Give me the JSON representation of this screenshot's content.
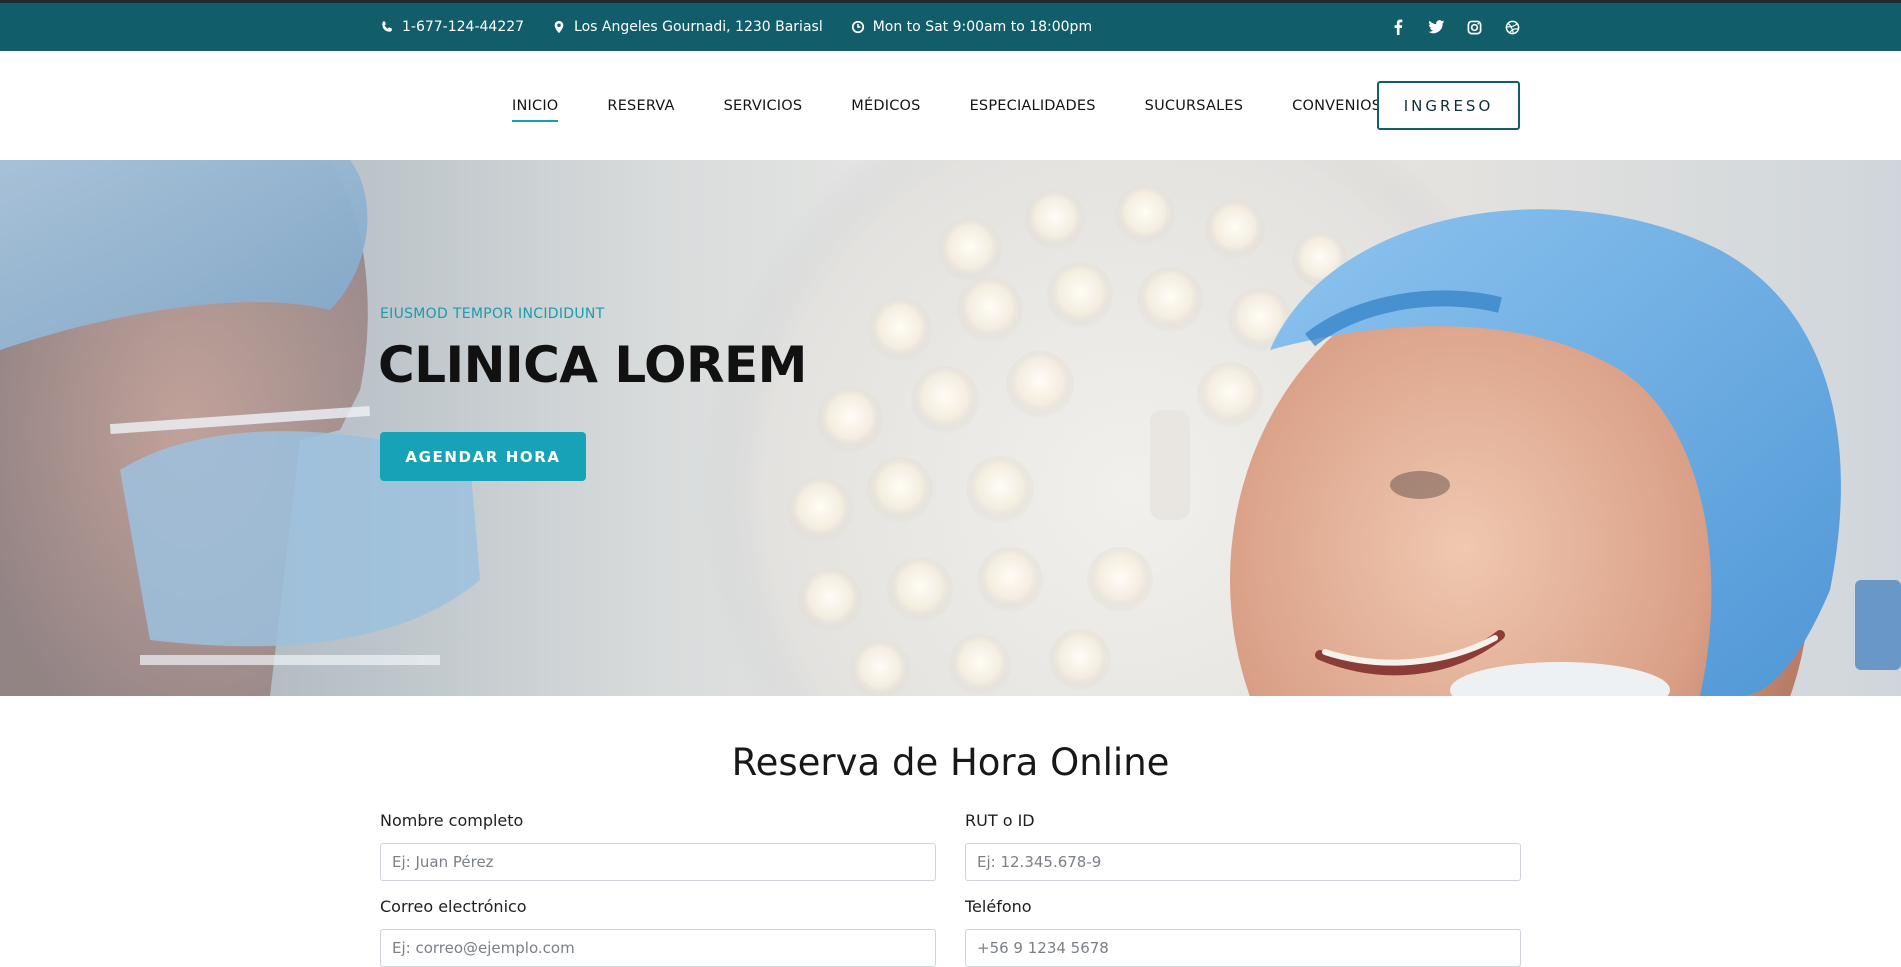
{
  "topbar": {
    "phone": "1-677-124-44227",
    "address": "Los Angeles Gournadi, 1230 Bariasl",
    "hours": "Mon to Sat 9:00am to 18:00pm",
    "socials": [
      "facebook-icon",
      "twitter-icon",
      "instagram-icon",
      "dribbble-icon"
    ]
  },
  "nav": {
    "items": [
      "INICIO",
      "RESERVA",
      "SERVICIOS",
      "MÉDICOS",
      "ESPECIALIDADES",
      "SUCURSALES",
      "CONVENIOS"
    ],
    "active": "INICIO",
    "login_label": "INGRESO"
  },
  "hero": {
    "eyebrow": "EIUSMOD TEMPOR INCIDIDUNT",
    "title": "CLINICA LOREM",
    "cta_label": "AGENDAR HORA"
  },
  "form": {
    "title": "Reserva de Hora Online",
    "fields": [
      {
        "label": "Nombre completo",
        "placeholder": "Ej: Juan Pérez"
      },
      {
        "label": "RUT o ID",
        "placeholder": "Ej: 12.345.678-9"
      },
      {
        "label": "Correo electrónico",
        "placeholder": "Ej: correo@ejemplo.com"
      },
      {
        "label": "Teléfono",
        "placeholder": "+56 9 1234 5678"
      }
    ]
  },
  "colors": {
    "topbar": "#115e6a",
    "accent": "#17a2b8",
    "heading": "#111111"
  }
}
